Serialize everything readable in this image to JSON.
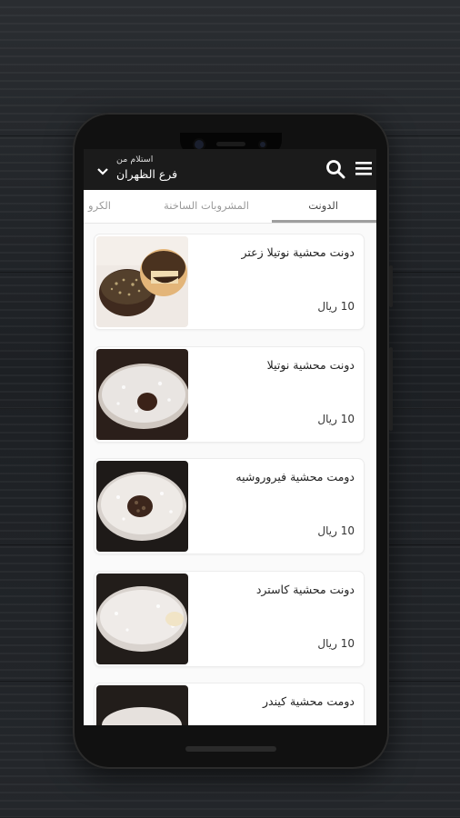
{
  "header": {
    "pickup_label": "استلام من",
    "branch_name": "فرع الظهران"
  },
  "tabs": [
    {
      "label": "الدونت",
      "active": true
    },
    {
      "label": "المشروبات الساخنة",
      "active": false
    },
    {
      "label": "الكرو",
      "active": false
    }
  ],
  "products": [
    {
      "name": "دونت محشية نوتيلا زعتر",
      "price": "10 ريال"
    },
    {
      "name": "دونت محشية نوتيلا",
      "price": "10 ريال"
    },
    {
      "name": "دومت محشية فيروروشيه",
      "price": "10 ريال"
    },
    {
      "name": "دونت محشية كاسترد",
      "price": "10 ريال"
    },
    {
      "name": "دومت محشية كيندر",
      "price": ""
    }
  ],
  "colors": {
    "appbar": "#1b1b1b",
    "background": "#fafafa",
    "tab_indicator": "#9e9e9e"
  },
  "icons": [
    "menu-icon",
    "search-icon",
    "chevron-down-icon"
  ]
}
